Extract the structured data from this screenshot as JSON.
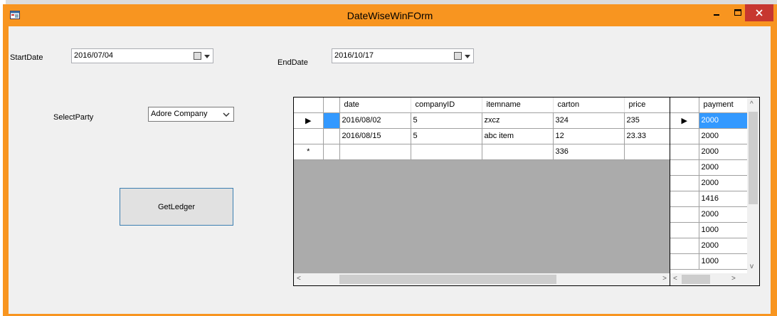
{
  "window": {
    "title": "DateWiseWinFOrm",
    "minimize_label": "🗕",
    "maximize_label": "🗖",
    "close_label": "✕"
  },
  "form": {
    "start_date_label": "StartDate",
    "start_date_value": "2016/07/04",
    "end_date_label": "EndDate",
    "end_date_value": "2016/10/17",
    "select_party_label": "SelectParty",
    "select_party_value": "Adore Company",
    "get_ledger_label": "GetLedger"
  },
  "grid1": {
    "columns": [
      "date",
      "companyID",
      "itemname",
      "carton",
      "price"
    ],
    "rows": [
      {
        "indicator": "▶",
        "date": "2016/08/02",
        "companyID": "5",
        "itemname": "zxcz",
        "carton": "324",
        "price": "235"
      },
      {
        "indicator": "",
        "date": "2016/08/15",
        "companyID": "5",
        "itemname": "abc item",
        "carton": "12",
        "price": "23.33"
      },
      {
        "indicator": "*",
        "date": "",
        "companyID": "",
        "itemname": "",
        "carton": "336",
        "price": ""
      }
    ],
    "scroll_left": "<",
    "scroll_right": ">"
  },
  "grid2": {
    "column": "payment",
    "rows": [
      {
        "indicator": "▶",
        "payment": "2000"
      },
      {
        "indicator": "",
        "payment": "2000"
      },
      {
        "indicator": "",
        "payment": "2000"
      },
      {
        "indicator": "",
        "payment": "2000"
      },
      {
        "indicator": "",
        "payment": "2000"
      },
      {
        "indicator": "",
        "payment": "1416"
      },
      {
        "indicator": "",
        "payment": "2000"
      },
      {
        "indicator": "",
        "payment": "1000"
      },
      {
        "indicator": "",
        "payment": "2000"
      },
      {
        "indicator": "",
        "payment": "1000"
      }
    ],
    "scroll_left": "<",
    "scroll_right": ">",
    "scroll_up": "^",
    "scroll_down": "v"
  },
  "colors": {
    "title_bar": "#f89520",
    "close_button": "#c7372f",
    "selection": "#3399ff",
    "grid_empty": "#ababab"
  }
}
